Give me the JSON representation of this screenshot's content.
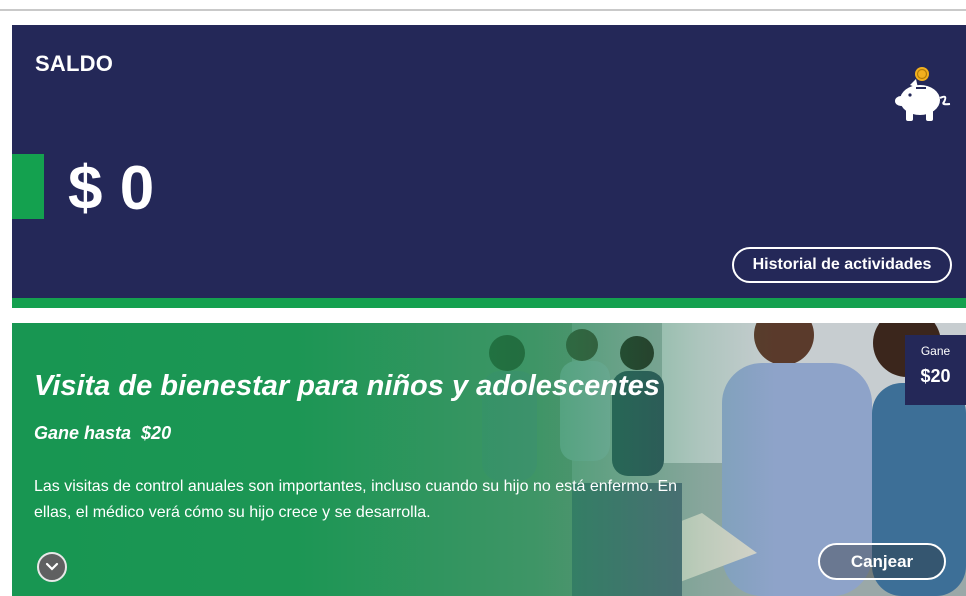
{
  "balance": {
    "title": "SALDO",
    "amount": "$ 0",
    "history_button": "Historial de actividades",
    "icon": "piggy-bank-icon"
  },
  "reward": {
    "title": "Visita de bienestar para niños y adolescentes",
    "subtitle": "Gane hasta  $20",
    "description": "Las visitas de control anuales son importantes, incluso cuando su hijo no está enfermo. En ellas, el médico verá cómo su hijo crece y se desarrolla.",
    "badge_label": "Gane",
    "badge_amount": "$20",
    "redeem_button": "Canjear",
    "expand_icon": "chevron-down-icon"
  },
  "colors": {
    "navy": "#242858",
    "green": "#14a14f",
    "white": "#ffffff"
  }
}
